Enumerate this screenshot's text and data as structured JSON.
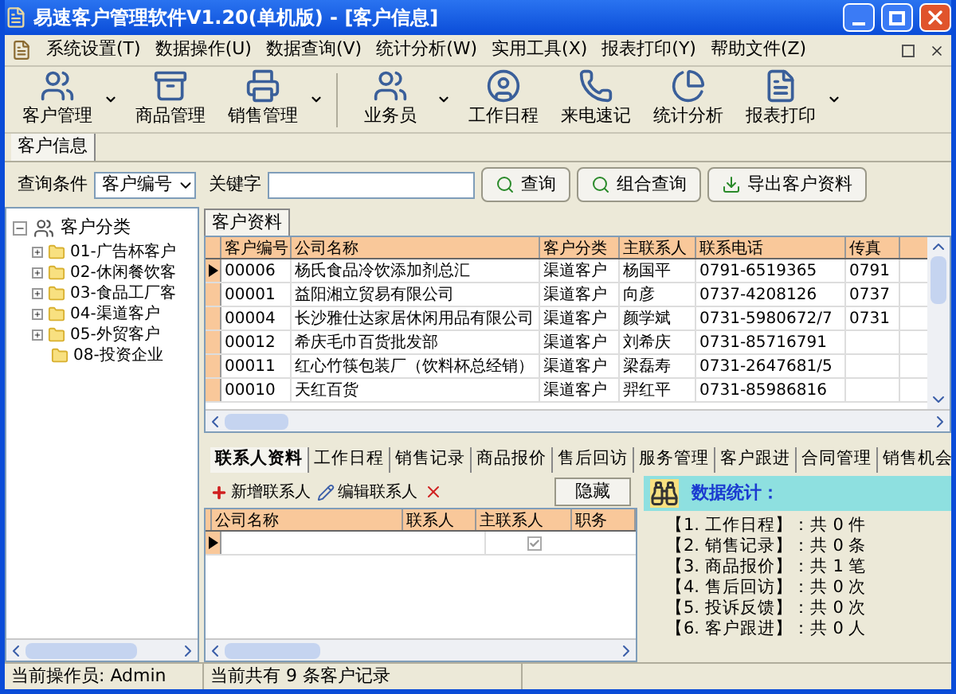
{
  "window": {
    "title": "易速客户管理软件V1.20(单机版) - [客户信息]"
  },
  "menu": [
    "系统设置(T)",
    "数据操作(U)",
    "数据查询(V)",
    "统计分析(W)",
    "实用工具(X)",
    "报表打印(Y)",
    "帮助文件(Z)"
  ],
  "toolbar": [
    {
      "label": "客户管理",
      "kind": "people",
      "dropdown": true
    },
    {
      "label": "商品管理",
      "kind": "cabinet",
      "dropdown": false
    },
    {
      "label": "销售管理",
      "kind": "printer",
      "dropdown": true
    },
    {
      "label": "业务员",
      "kind": "group",
      "dropdown": true
    },
    {
      "label": "工作日程",
      "kind": "person",
      "dropdown": false
    },
    {
      "label": "来电速记",
      "kind": "phone",
      "dropdown": false
    },
    {
      "label": "统计分析",
      "kind": "chart",
      "dropdown": false
    },
    {
      "label": "报表打印",
      "kind": "report",
      "dropdown": true
    }
  ],
  "doc_tabs": [
    {
      "label": "客户信息",
      "selected": true
    }
  ],
  "query": {
    "condition_label": "查询条件",
    "condition_value": "客户编号",
    "keyword_label": "关键字",
    "buttons": [
      "查询",
      "组合查询",
      "导出客户资料"
    ]
  },
  "tree": {
    "label": "客户分类",
    "expanded": true,
    "children": [
      {
        "label": "01-广告杯客户",
        "expanded": false
      },
      {
        "label": "02-休闲餐饮客",
        "expanded": false
      },
      {
        "label": "03-食品工厂客",
        "expanded": false
      },
      {
        "label": "04-渠道客户",
        "expanded": false
      },
      {
        "label": "05-外贸客户",
        "expanded": false
      },
      {
        "label": "08-投资企业"
      }
    ]
  },
  "customer_tab": "客户资料",
  "table": {
    "columns": [
      "客户编号",
      "公司名称",
      "客户分类",
      "主联系人",
      "联系电话",
      "传真"
    ],
    "rows": [
      {
        "selected": true,
        "cells": [
          "00006",
          "杨氏食品冷饮添加剂总汇",
          "渠道客户",
          "杨国平",
          "0791-6519365",
          "0791"
        ]
      },
      {
        "selected": false,
        "cells": [
          "00001",
          "益阳湘立贸易有限公司",
          "渠道客户",
          "向彦",
          "0737-4208126",
          "0737"
        ]
      },
      {
        "selected": false,
        "cells": [
          "00004",
          "长沙雅仕达家居休闲用品有限公司",
          "渠道客户",
          "颜学斌",
          "0731-5980672/7",
          "0731"
        ]
      },
      {
        "selected": false,
        "cells": [
          "00012",
          "希庆毛巾百货批发部",
          "渠道客户",
          "刘希庆",
          "0731-85716791",
          ""
        ]
      },
      {
        "selected": false,
        "cells": [
          "00011",
          "红心竹筷包装厂（饮料杯总经销）",
          "渠道客户",
          "梁磊寿",
          "0731-2647681/5",
          ""
        ]
      },
      {
        "selected": false,
        "cells": [
          "00010",
          "天红百货",
          "渠道客户",
          "羿红平",
          "0731-85986816",
          ""
        ]
      }
    ]
  },
  "detail_tabs": [
    {
      "label": "联系人资料",
      "selected": true
    },
    {
      "label": "工作日程",
      "selected": false
    },
    {
      "label": "销售记录",
      "selected": false
    },
    {
      "label": "商品报价",
      "selected": false
    },
    {
      "label": "售后回访",
      "selected": false
    },
    {
      "label": "服务管理",
      "selected": false
    },
    {
      "label": "客户跟进",
      "selected": false
    },
    {
      "label": "合同管理",
      "selected": false
    },
    {
      "label": "销售机会",
      "selected": false
    }
  ],
  "contact_toolbar": {
    "add": "新增联系人",
    "edit": "编辑联系人",
    "hide": "隐藏"
  },
  "contacts": {
    "columns": [
      "公司名称",
      "联系人",
      "主联系人",
      "职务"
    ],
    "rows": [
      {
        "selected": true,
        "main_contact": true
      }
    ]
  },
  "stats": {
    "title": "数据统计：",
    "lines": [
      "【1. 工作日程】：共 0 件",
      "【2. 销售记录】：共 0 条",
      "【3. 商品报价】：共 1 笔",
      "【4. 售后回访】：共 0 次",
      "【5. 投诉反馈】：共 0 次",
      "【6. 客户跟进】：共 0 人"
    ]
  },
  "status_bar": {
    "operator": "当前操作员: Admin",
    "records": "当前共有 9 条客户记录"
  }
}
